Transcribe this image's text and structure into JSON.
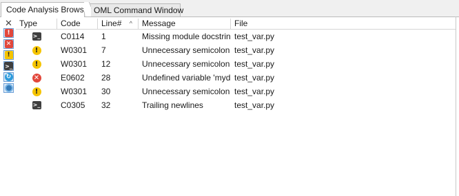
{
  "tabs": [
    {
      "label": "Code Analysis Browser",
      "active": true
    },
    {
      "label": "OML Command Window",
      "active": false
    }
  ],
  "filters": [
    {
      "name": "close",
      "glyph": "✕"
    },
    {
      "name": "errors",
      "glyph": "!",
      "icon": "error-icon"
    },
    {
      "name": "errors2",
      "glyph": "✕",
      "icon": "error-icon"
    },
    {
      "name": "warnings",
      "glyph": "!",
      "icon": "warning-icon"
    },
    {
      "name": "conventions",
      "glyph": ">_",
      "icon": "convention-icon"
    },
    {
      "name": "refactor",
      "glyph": "↻",
      "icon": "refactor-icon"
    },
    {
      "name": "info",
      "glyph": "",
      "icon": "info-icon"
    }
  ],
  "columns": {
    "type": "Type",
    "code": "Code",
    "line": "Line#",
    "message": "Message",
    "file": "File",
    "sort_glyph": "^"
  },
  "rows": [
    {
      "type": "convention",
      "code": "C0114",
      "line": "1",
      "message": "Missing module docstring",
      "file": "test_var.py"
    },
    {
      "type": "warning",
      "code": "W0301",
      "line": "7",
      "message": "Unnecessary semicolon",
      "file": "test_var.py"
    },
    {
      "type": "warning",
      "code": "W0301",
      "line": "12",
      "message": "Unnecessary semicolon",
      "file": "test_var.py"
    },
    {
      "type": "error",
      "code": "E0602",
      "line": "28",
      "message": "Undefined variable 'mydict'",
      "file": "test_var.py"
    },
    {
      "type": "warning",
      "code": "W0301",
      "line": "30",
      "message": "Unnecessary semicolon",
      "file": "test_var.py"
    },
    {
      "type": "convention",
      "code": "C0305",
      "line": "32",
      "message": "Trailing newlines",
      "file": "test_var.py"
    }
  ],
  "colors": {
    "error": "#e2473b",
    "warning": "#f5c400",
    "convention": "#3f3f3f",
    "refactor": "#2e9bdc",
    "info": "#357ab8"
  }
}
